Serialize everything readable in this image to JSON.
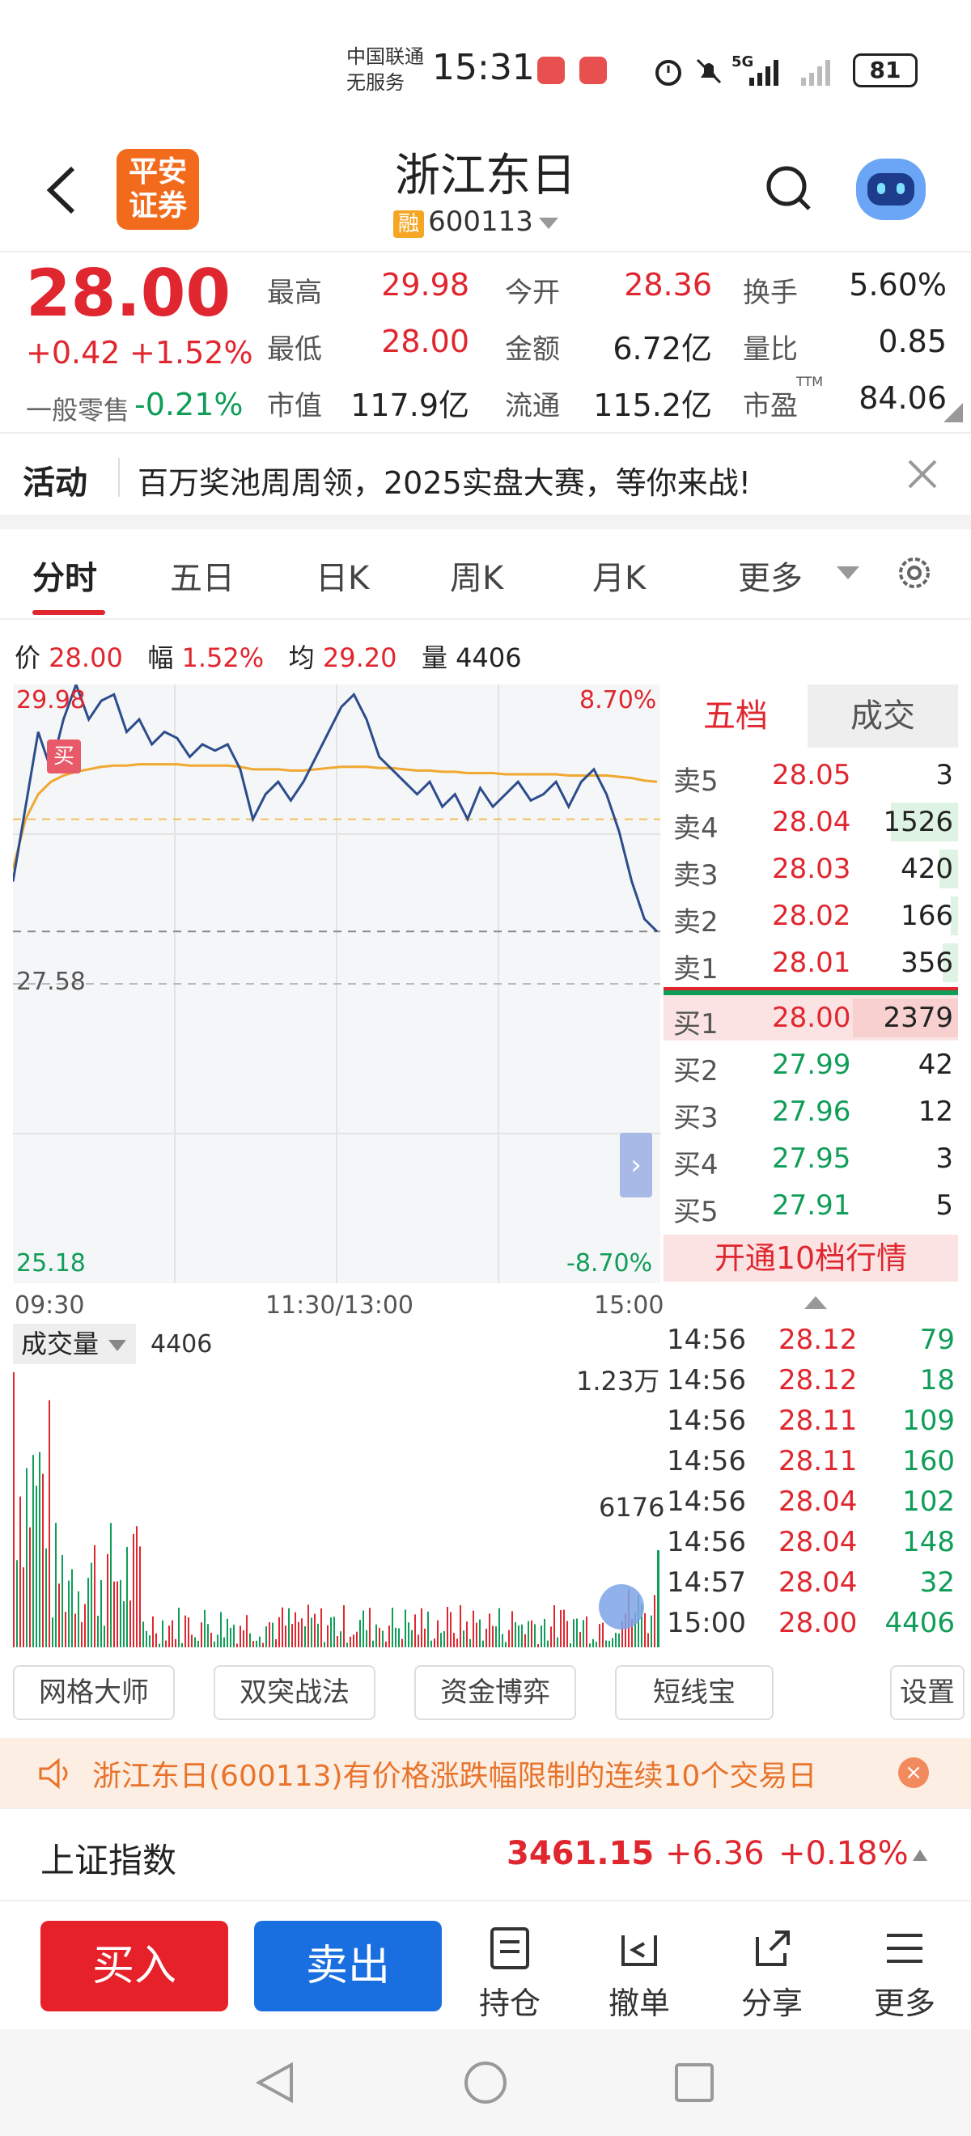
{
  "status_bar": {
    "carrier_line1": "中国联通",
    "carrier_line2": "无服务",
    "time": "15:31",
    "battery": "81",
    "network": "5G"
  },
  "header": {
    "title": "浙江东日",
    "rong_badge": "融",
    "code": "600113",
    "broker_logo_line1": "平安",
    "broker_logo_line2": "证券"
  },
  "quote": {
    "price": "28.00",
    "change": "+0.42",
    "change_pct": "+1.52%",
    "retail_label": "一般零售",
    "retail_value": "-0.21%",
    "stats": [
      {
        "label": "最高",
        "value": "29.98",
        "color": "red"
      },
      {
        "label": "今开",
        "value": "28.36",
        "color": "red"
      },
      {
        "label": "换手",
        "value": "5.60%",
        "color": "blk"
      },
      {
        "label": "最低",
        "value": "28.00",
        "color": "red"
      },
      {
        "label": "金额",
        "value": "6.72亿",
        "color": "blk"
      },
      {
        "label": "量比",
        "value": "0.85",
        "color": "blk"
      },
      {
        "label": "市值",
        "value": "117.9亿",
        "color": "blk"
      },
      {
        "label": "流通",
        "value": "115.2亿",
        "color": "blk"
      },
      {
        "label": "市盈",
        "value": "84.06",
        "color": "blk"
      }
    ],
    "pe_sup": "TTM"
  },
  "activity": {
    "label": "活动",
    "text": "百万奖池周周领，2025实盘大赛，等你来战!"
  },
  "tabs": [
    "分时",
    "五日",
    "日K",
    "周K",
    "月K",
    "更多"
  ],
  "active_tab": "分时",
  "chart_header": {
    "price_label": "价",
    "price": "28.00",
    "range_label": "幅",
    "range": "1.52%",
    "avg_label": "均",
    "avg": "29.20",
    "vol_label": "量",
    "vol": "4406"
  },
  "chart_data": {
    "type": "line",
    "y_top": "29.98",
    "y_mid": "27.58",
    "y_bottom": "25.18",
    "pct_top": "8.70%",
    "pct_bottom": "-8.70%",
    "x_labels": [
      "09:30",
      "11:30/13:00",
      "15:00"
    ],
    "buy_marker": "买",
    "ylim": [
      25.18,
      29.98
    ],
    "price_series": [
      28.4,
      29.0,
      29.6,
      29.3,
      29.7,
      29.98,
      29.7,
      29.85,
      29.9,
      29.6,
      29.7,
      29.5,
      29.6,
      29.55,
      29.4,
      29.5,
      29.45,
      29.5,
      29.3,
      28.9,
      29.1,
      29.2,
      29.05,
      29.2,
      29.4,
      29.6,
      29.8,
      29.9,
      29.7,
      29.4,
      29.3,
      29.2,
      29.1,
      29.2,
      29.0,
      29.1,
      28.9,
      29.15,
      29.0,
      29.1,
      29.2,
      29.05,
      29.1,
      29.2,
      29.0,
      29.2,
      29.3,
      29.1,
      28.8,
      28.4,
      28.1,
      28.0
    ],
    "avg_series": [
      28.5,
      28.9,
      29.1,
      29.2,
      29.25,
      29.28,
      29.3,
      29.32,
      29.33,
      29.33,
      29.34,
      29.34,
      29.34,
      29.34,
      29.33,
      29.33,
      29.33,
      29.33,
      29.32,
      29.3,
      29.3,
      29.3,
      29.29,
      29.29,
      29.3,
      29.31,
      29.32,
      29.32,
      29.32,
      29.31,
      29.31,
      29.3,
      29.29,
      29.29,
      29.28,
      29.28,
      29.27,
      29.27,
      29.27,
      29.26,
      29.26,
      29.26,
      29.26,
      29.26,
      29.25,
      29.25,
      29.25,
      29.25,
      29.24,
      29.23,
      29.21,
      29.2
    ],
    "volume_label": "成交量",
    "volume_value": "4406",
    "vol_top": "1.23万",
    "vol_mid": "6176"
  },
  "order_book": {
    "tab_active": "五档",
    "tab_other": "成交",
    "asks": [
      {
        "label": "卖5",
        "price": "28.05",
        "vol": "3",
        "bar": 0.0
      },
      {
        "label": "卖4",
        "price": "28.04",
        "vol": "1526",
        "bar": 0.64
      },
      {
        "label": "卖3",
        "price": "28.03",
        "vol": "420",
        "bar": 0.18
      },
      {
        "label": "卖2",
        "price": "28.02",
        "vol": "166",
        "bar": 0.07
      },
      {
        "label": "卖1",
        "price": "28.01",
        "vol": "356",
        "bar": 0.15
      }
    ],
    "bids": [
      {
        "label": "买1",
        "price": "28.00",
        "vol": "2379",
        "bar": 1.0
      },
      {
        "label": "买2",
        "price": "27.99",
        "vol": "42",
        "bar": 0
      },
      {
        "label": "买3",
        "price": "27.96",
        "vol": "12",
        "bar": 0
      },
      {
        "label": "买4",
        "price": "27.95",
        "vol": "3",
        "bar": 0
      },
      {
        "label": "买5",
        "price": "27.91",
        "vol": "5",
        "bar": 0
      }
    ],
    "upgrade": "开通10档行情"
  },
  "ticks": [
    {
      "time": "14:56",
      "price": "28.12",
      "vol": "79"
    },
    {
      "time": "14:56",
      "price": "28.12",
      "vol": "18"
    },
    {
      "time": "14:56",
      "price": "28.11",
      "vol": "109"
    },
    {
      "time": "14:56",
      "price": "28.11",
      "vol": "160"
    },
    {
      "time": "14:56",
      "price": "28.04",
      "vol": "102"
    },
    {
      "time": "14:56",
      "price": "28.04",
      "vol": "148"
    },
    {
      "time": "14:57",
      "price": "28.04",
      "vol": "32"
    },
    {
      "time": "15:00",
      "price": "28.00",
      "vol": "4406"
    }
  ],
  "tools": [
    "网格大师",
    "双突战法",
    "资金博弈",
    "短线宝",
    "设置"
  ],
  "notice": "浙江东日(600113)有价格涨跌幅限制的连续10个交易日",
  "index": {
    "name": "上证指数",
    "value": "3461.15",
    "change": "+6.36",
    "pct": "+0.18%"
  },
  "actions": {
    "buy": "买入",
    "sell": "卖出",
    "holdings": "持仓",
    "cancel": "撤单",
    "share": "分享",
    "more": "更多"
  }
}
